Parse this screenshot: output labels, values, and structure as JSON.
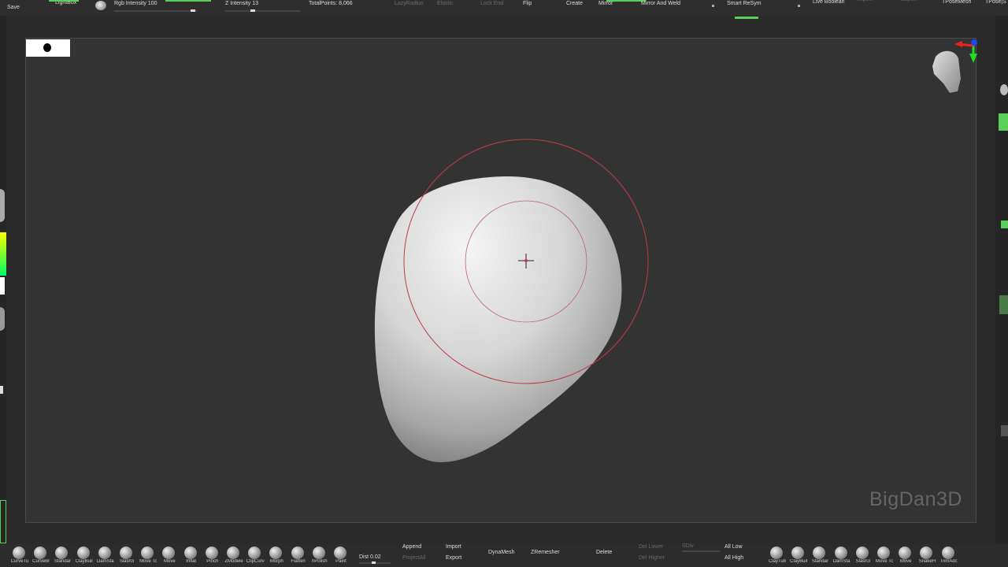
{
  "top_bar": {
    "save": "Save",
    "lightbox": "LightBox",
    "rgb_intensity": "Rgb Intensity 100",
    "z_intensity": "Z Intensity 13",
    "total_points": "TotalPoints: 8,066",
    "lazy_radius": "LazyRadius",
    "elastic": "Elastic",
    "lock_end": "Lock End",
    "flip": "Flip",
    "create": "Create",
    "mirror": "Mirror",
    "mirror_and_weld": "Mirror And Weld",
    "smart_resym": "Smart ReSym",
    "live_boolean": "Live Boolean",
    "tposemesh": "TPoseMesh",
    "tpose_ss": "TPose|S",
    "accent_color": "#5ad05a"
  },
  "watermark": "BigDan3D",
  "bottom_bar": {
    "brushes_left": [
      "CurveTu",
      "CurveBr",
      "Standar",
      "ClayBuil",
      "DamSta",
      "Slash3",
      "Move Tc",
      "Move",
      "Inflat",
      "Pinch",
      "ZModele",
      "ClipCurv",
      "Morph",
      "Flatten",
      "hPolish",
      "Paint"
    ],
    "dist": "Dist 0.02",
    "append": "Append",
    "import": "Import",
    "project_all": "ProjectAll",
    "export": "Export",
    "dynamesh": "DynaMesh",
    "zremesher": "ZRemesher",
    "delete": "Delete",
    "del_lower": "Del Lower",
    "del_higher": "Del Higher",
    "sdiv": "SDiv",
    "all_low": "All Low",
    "all_high": "All High",
    "brushes_right": [
      "ClayTub",
      "ClayBuil",
      "Standar",
      "DamSta",
      "Slash3",
      "Move Tc",
      "Move",
      "SnakeH",
      "TrimAdc",
      "Snake"
    ]
  }
}
